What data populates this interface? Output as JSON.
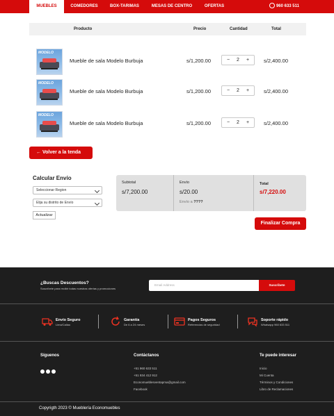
{
  "nav": {
    "items": [
      "MUEBLES",
      "COMEDORES",
      "BOX-TARIMAS",
      "MESAS DE CENTRO",
      "OFERTAS"
    ],
    "phone": "960 633 511"
  },
  "cart": {
    "headers": {
      "product": "Producto",
      "price": "Precio",
      "quantity": "Cantidad",
      "total": "Total"
    },
    "rows": [
      {
        "thumb_label": "MODELO",
        "name": "Mueble de sala Modelo Burbuja",
        "price": "s/1,200.00",
        "qty": "2",
        "total": "s/2,400.00"
      },
      {
        "thumb_label": "MODELO",
        "name": "Mueble de sala Modelo Burbuja",
        "price": "s/1,200.00",
        "qty": "2",
        "total": "s/2,400.00"
      },
      {
        "thumb_label": "MODELO",
        "name": "Mueble de sala Modelo Burbuja",
        "price": "s/1,200.00",
        "qty": "2",
        "total": "s/2,400.00"
      }
    ],
    "minus": "−",
    "plus": "+",
    "back_label": "← Volver a la tenda"
  },
  "shipping": {
    "title": "Calcular Envío",
    "region_placeholder": "Seleccionar Region",
    "district_placeholder": "Elija su distrito de Envío",
    "update_label": "Actualizar"
  },
  "summary": {
    "subtotal_label": "Subtotal",
    "subtotal_value": "s/7,200.00",
    "shipping_label": "Envío",
    "shipping_value": "s/20.00",
    "shipping_note_prefix": "Envío a ",
    "shipping_note_value": "????",
    "total_label": "Total",
    "total_value": "s/7,220.00",
    "finish_label": "Finalizar Compra"
  },
  "footer": {
    "newsletter_title": "¿Buscas Descuentos?",
    "newsletter_sub": "Suscríbete para recibir todas nuestras ofertas y promociones",
    "email_placeholder": "Email Address",
    "subscribe_label": "Suscribete",
    "features": [
      {
        "title": "Envío Seguro",
        "sub": "Lima/Callao"
      },
      {
        "title": "Garantía",
        "sub": "De 6 a 24 meses"
      },
      {
        "title": "Pagos Seguros",
        "sub": "Referencias de seguridad"
      },
      {
        "title": "Soporte rápido",
        "sub": "Whatsapp 960 633 511"
      }
    ],
    "follow_title": "Síguenos",
    "contact_title": "Contáctanos",
    "contact_items": [
      "+51 960 633 511",
      "+51 934 412 912",
      "Economueblesventapma@gmail.com",
      "Facebook"
    ],
    "interest_title": "Te puede interesar",
    "interest_items": [
      "Inicio",
      "Mi Cuenta",
      "Términos y Condiciones",
      "Libro de Reclamaciones"
    ],
    "copyright": "Copyrigth 2023 © Mueblería Economuebles"
  },
  "colors": {
    "brand": "#d50b0b",
    "footer_bg": "#1e1e1e",
    "summary_bg": "#e0e0e0"
  }
}
